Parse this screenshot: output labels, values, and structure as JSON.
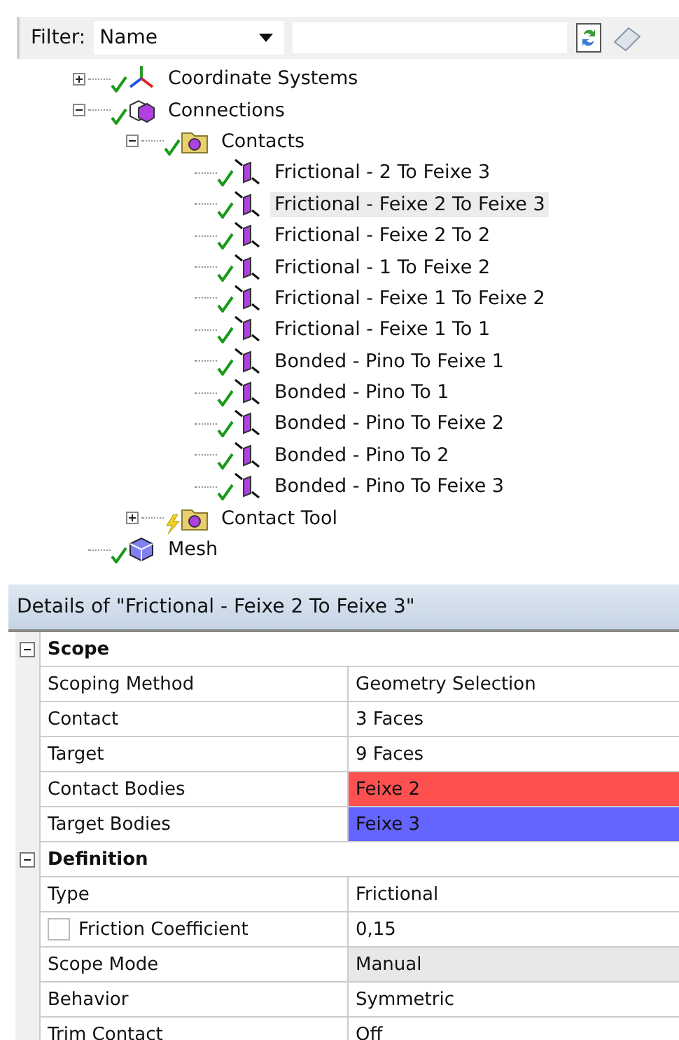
{
  "filter": {
    "label": "Filter:",
    "choice": "Name"
  },
  "tree": [
    {
      "label": "Coordinate Systems",
      "kind": "axes",
      "up_to_date": true,
      "expanded": false,
      "selected": false
    },
    {
      "label": "Connections",
      "kind": "connections",
      "up_to_date": true,
      "expanded": true,
      "selected": false,
      "children": [
        {
          "label": "Contacts",
          "kind": "folder",
          "up_to_date": true,
          "expanded": true,
          "selected": false,
          "children": [
            {
              "label": "Frictional - 2 To Feixe 3",
              "kind": "contact",
              "up_to_date": true,
              "selected": false
            },
            {
              "label": "Frictional - Feixe 2 To Feixe 3",
              "kind": "contact",
              "up_to_date": true,
              "selected": true
            },
            {
              "label": "Frictional - Feixe 2 To 2",
              "kind": "contact",
              "up_to_date": true,
              "selected": false
            },
            {
              "label": "Frictional - 1 To Feixe 2",
              "kind": "contact",
              "up_to_date": true,
              "selected": false
            },
            {
              "label": "Frictional - Feixe 1 To Feixe 2",
              "kind": "contact",
              "up_to_date": true,
              "selected": false
            },
            {
              "label": "Frictional - Feixe 1 To 1",
              "kind": "contact",
              "up_to_date": true,
              "selected": false
            },
            {
              "label": "Bonded - Pino To Feixe 1",
              "kind": "contact",
              "up_to_date": true,
              "selected": false
            },
            {
              "label": "Bonded - Pino To 1",
              "kind": "contact",
              "up_to_date": true,
              "selected": false
            },
            {
              "label": "Bonded - Pino To Feixe 2",
              "kind": "contact",
              "up_to_date": true,
              "selected": false
            },
            {
              "label": "Bonded - Pino To 2",
              "kind": "contact",
              "up_to_date": true,
              "selected": false
            },
            {
              "label": "Bonded - Pino To Feixe 3",
              "kind": "contact",
              "up_to_date": true,
              "selected": false
            }
          ]
        },
        {
          "label": "Contact Tool",
          "kind": "folder",
          "up_to_date": false,
          "expanded": false,
          "selected": false
        }
      ]
    },
    {
      "label": "Mesh",
      "kind": "mesh",
      "up_to_date": true,
      "selected": false
    }
  ],
  "details": {
    "title": "Details of \"Frictional - Feixe 2 To Feixe 3\"",
    "rows": [
      {
        "kind": "group",
        "label": "Scope",
        "expanded": true
      },
      {
        "kind": "property",
        "label": "Scoping Method",
        "value": "Geometry Selection"
      },
      {
        "kind": "property",
        "label": "Contact",
        "value": "3 Faces"
      },
      {
        "kind": "property",
        "label": "Target",
        "value": "9 Faces"
      },
      {
        "kind": "property",
        "label": "Contact Bodies",
        "value": "Feixe 2",
        "color": "#ff5050"
      },
      {
        "kind": "property",
        "label": "Target Bodies",
        "value": "Feixe 3",
        "color": "#6464ff"
      },
      {
        "kind": "group",
        "label": "Definition",
        "expanded": true
      },
      {
        "kind": "property",
        "label": "Type",
        "value": "Frictional"
      },
      {
        "kind": "property",
        "label": "Friction Coefficient",
        "value": "0,15",
        "checked": false
      },
      {
        "kind": "property",
        "label": "Scope Mode",
        "value": "Manual",
        "disabled": true
      },
      {
        "kind": "property",
        "label": "Behavior",
        "value": "Symmetric"
      },
      {
        "kind": "property",
        "label": "Trim Contact",
        "value": "Off"
      }
    ]
  }
}
